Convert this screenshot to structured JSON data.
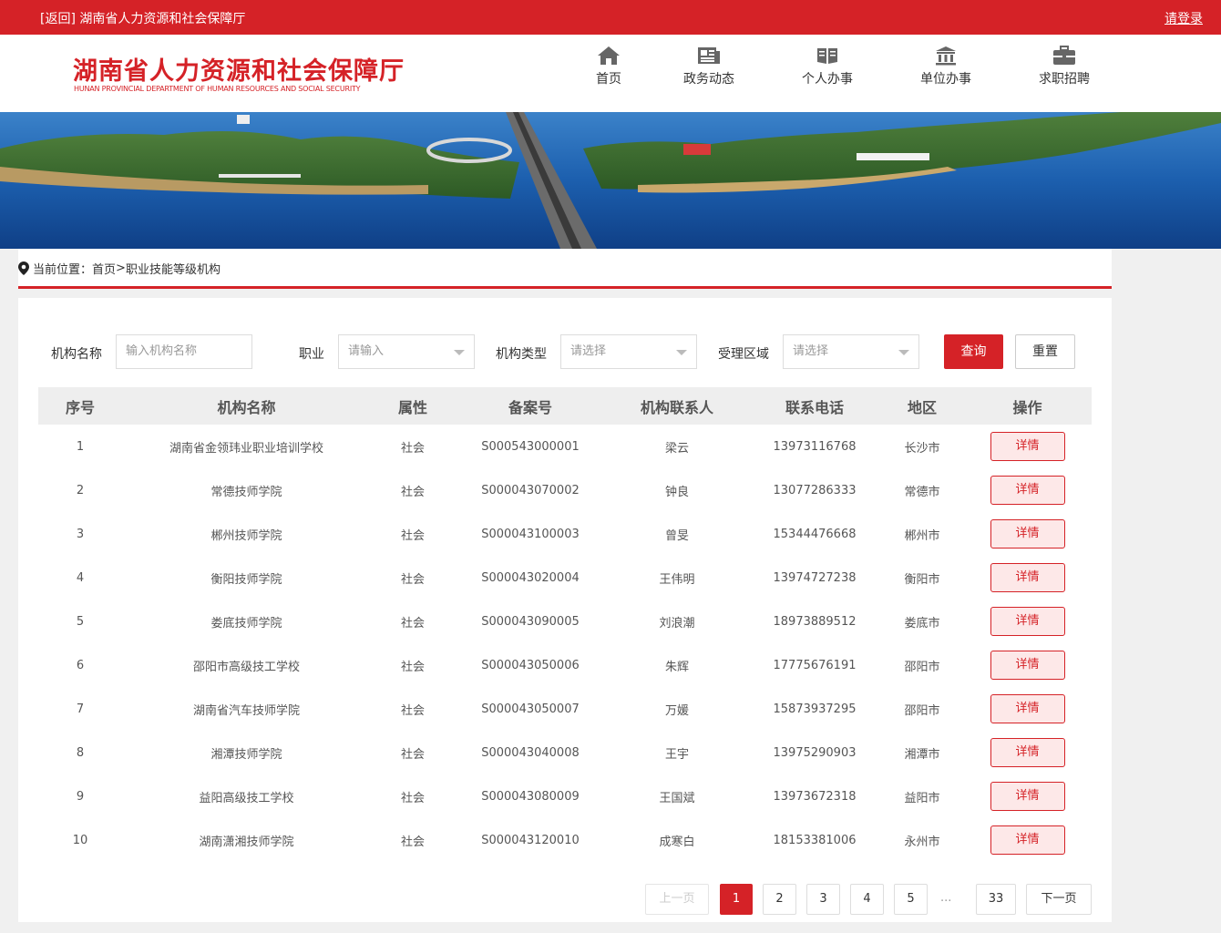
{
  "topbar": {
    "back_label": "[返回]  湖南省人力资源和社会保障厅",
    "login_label": "请登录"
  },
  "header": {
    "logo_cn": "湖南省人力资源和社会保障厅",
    "logo_en": "HUNAN PROVINCIAL DEPARTMENT OF HUMAN RESOURCES AND SOCIAL SECURITY",
    "nav": [
      {
        "label": "首页",
        "icon": "home-icon"
      },
      {
        "label": "政务动态",
        "icon": "newspaper-icon"
      },
      {
        "label": "个人办事",
        "icon": "book-icon"
      },
      {
        "label": "单位办事",
        "icon": "building-icon"
      },
      {
        "label": "求职招聘",
        "icon": "briefcase-icon"
      }
    ]
  },
  "breadcrumb": {
    "prefix": "当前位置：",
    "home": "首页",
    "sep": "> ",
    "current": "职业技能等级机构"
  },
  "filters": {
    "name_label": "机构名称",
    "name_placeholder": "输入机构名称",
    "job_label": "职业",
    "job_placeholder": "请输入",
    "type_label": "机构类型",
    "type_placeholder": "请选择",
    "area_label": "受理区域",
    "area_placeholder": "请选择",
    "query_label": "查询",
    "reset_label": "重置"
  },
  "table": {
    "headers": [
      "序号",
      "机构名称",
      "属性",
      "备案号",
      "机构联系人",
      "联系电话",
      "地区",
      "操作"
    ],
    "detail_label": "详情",
    "rows": [
      [
        "1",
        "湖南省金领玮业职业培训学校",
        "社会",
        "S000543000001",
        "梁云",
        "13973116768",
        "长沙市"
      ],
      [
        "2",
        "常德技师学院",
        "社会",
        "S000043070002",
        "钟良",
        "13077286333",
        "常德市"
      ],
      [
        "3",
        "郴州技师学院",
        "社会",
        "S000043100003",
        "曾旻",
        "15344476668",
        "郴州市"
      ],
      [
        "4",
        "衡阳技师学院",
        "社会",
        "S000043020004",
        "王伟明",
        "13974727238",
        "衡阳市"
      ],
      [
        "5",
        "娄底技师学院",
        "社会",
        "S000043090005",
        "刘浪潮",
        "18973889512",
        "娄底市"
      ],
      [
        "6",
        "邵阳市高级技工学校",
        "社会",
        "S000043050006",
        "朱辉",
        "17775676191",
        "邵阳市"
      ],
      [
        "7",
        "湖南省汽车技师学院",
        "社会",
        "S000043050007",
        "万媛",
        "15873937295",
        "邵阳市"
      ],
      [
        "8",
        "湘潭技师学院",
        "社会",
        "S000043040008",
        "王宇",
        "13975290903",
        "湘潭市"
      ],
      [
        "9",
        "益阳高级技工学校",
        "社会",
        "S000043080009",
        "王国斌",
        "13973672318",
        "益阳市"
      ],
      [
        "10",
        "湖南潇湘技师学院",
        "社会",
        "S000043120010",
        "成寒白",
        "18153381006",
        "永州市"
      ]
    ]
  },
  "pagination": {
    "prev_label": "上一页",
    "next_label": "下一页",
    "pages": [
      "1",
      "2",
      "3",
      "4",
      "5"
    ],
    "ellipsis": "...",
    "last": "33",
    "current": "1"
  },
  "colors": {
    "brand": "#d52227",
    "header_bg": "#ffffff",
    "page_bg": "#f0f0f0"
  }
}
